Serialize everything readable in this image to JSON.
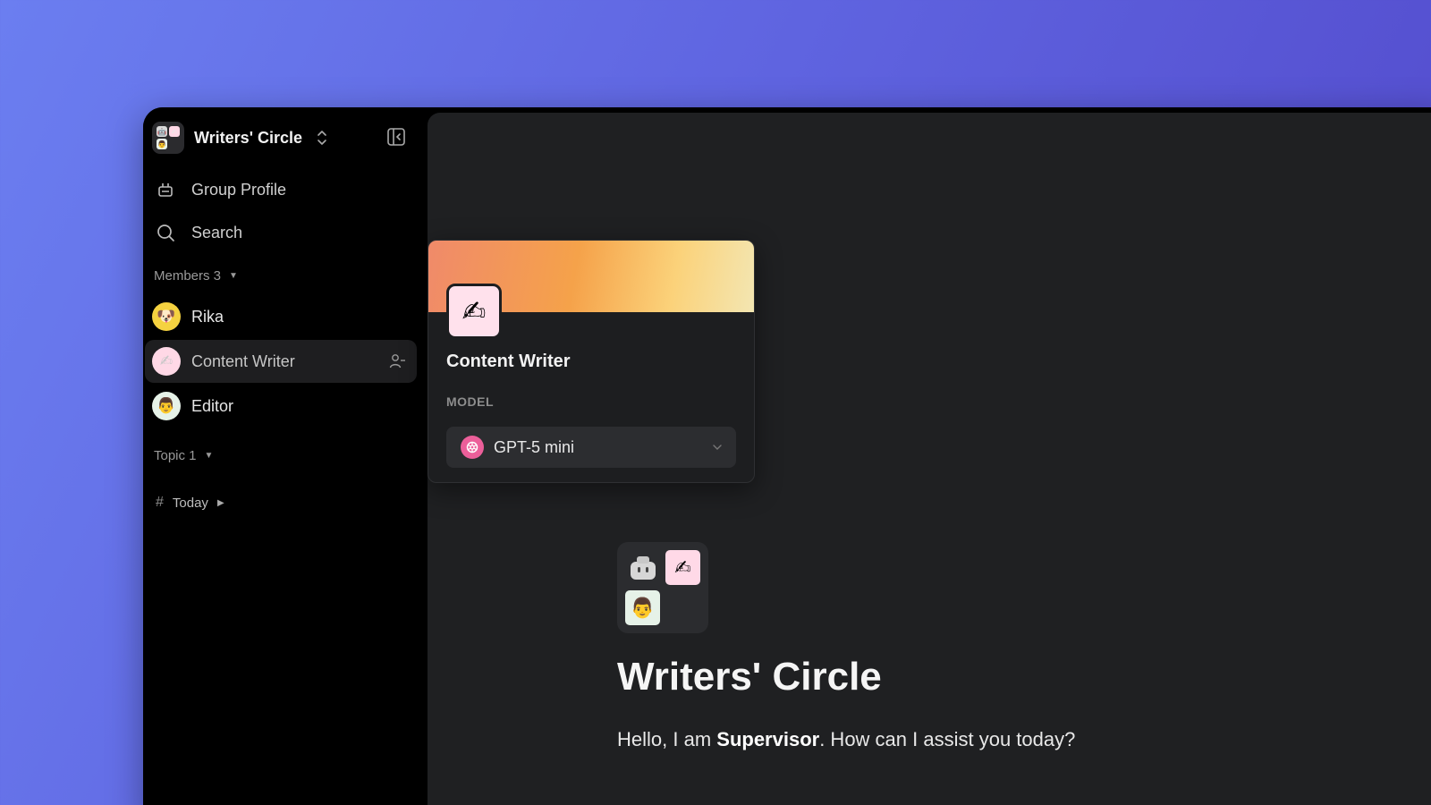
{
  "group": {
    "name": "Writers' Circle",
    "avatar_icons": [
      "robot-icon",
      "pen-hand-icon",
      "painter-icon"
    ]
  },
  "nav": {
    "group_profile": "Group Profile",
    "search": "Search"
  },
  "members": {
    "label": "Members 3",
    "items": [
      {
        "name": "Rika",
        "icon": "rika-avatar"
      },
      {
        "name": "Content Writer",
        "icon": "pen-hand-icon",
        "active": true
      },
      {
        "name": "Editor",
        "icon": "painter-icon"
      }
    ]
  },
  "topics": {
    "label": "Topic 1",
    "items": [
      {
        "name": "Today"
      }
    ]
  },
  "agent_card": {
    "name": "Content Writer",
    "model_label": "MODEL",
    "model_value": "GPT-5 mini"
  },
  "welcome": {
    "title": "Writers' Circle",
    "greeting_prefix": "Hello, I am ",
    "greeting_name": "Supervisor",
    "greeting_suffix": ". How can I assist you today?"
  },
  "colors": {
    "background": "#5f64e0",
    "sidebar": "#000000",
    "main": "#1f2022",
    "model_icon": "#ec5f9a"
  }
}
